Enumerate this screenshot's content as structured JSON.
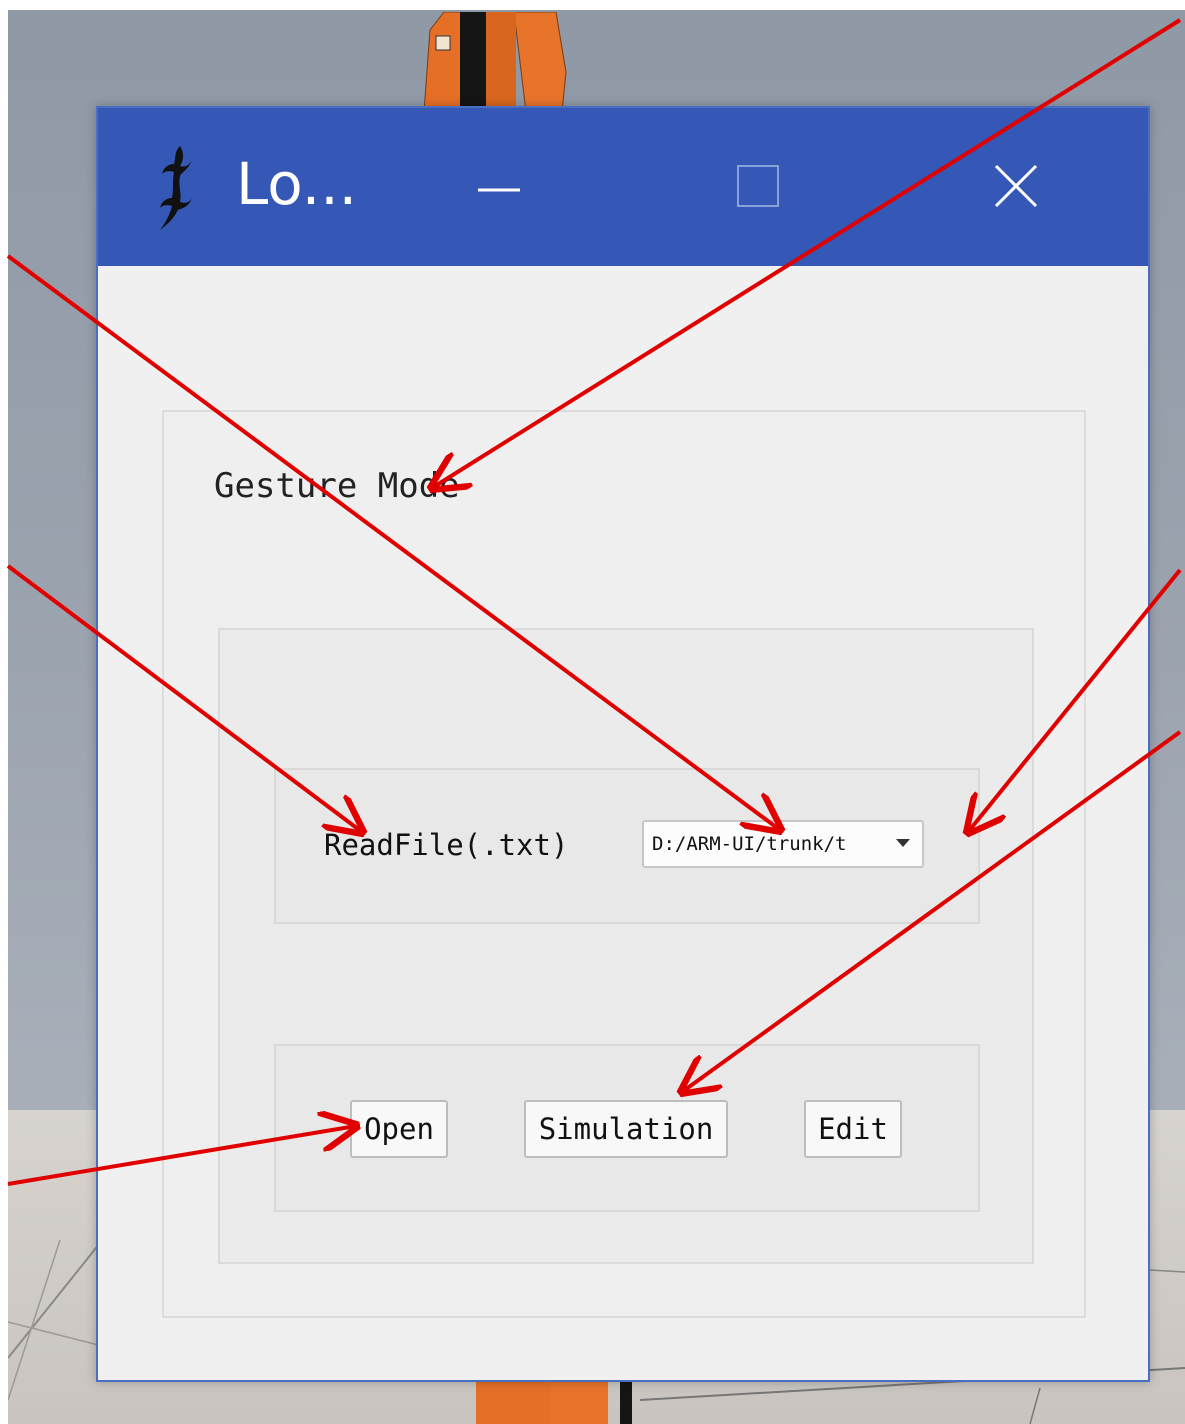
{
  "window": {
    "title": "Lo...",
    "minimize_glyph": "—",
    "maximize_glyph": "□",
    "close_glyph": "✕"
  },
  "group": {
    "label": "Gesture Mode"
  },
  "file_row": {
    "label": "ReadFile(.txt)",
    "path_value": "D:/ARM-UI/trunk/t"
  },
  "actions": {
    "open_label": "Open",
    "simulation_label": "Simulation",
    "edit_label": "Edit"
  },
  "icons": {
    "app_icon": "gecko-icon",
    "minimize": "minimize-icon",
    "maximize": "maximize-icon",
    "close": "close-icon",
    "dropdown": "chevron-down-icon"
  },
  "colors": {
    "titlebar": "#3557b5",
    "window_bg": "#f0f0f0",
    "annotation_arrow": "#e00000",
    "robot_arm": "#e8722a"
  }
}
